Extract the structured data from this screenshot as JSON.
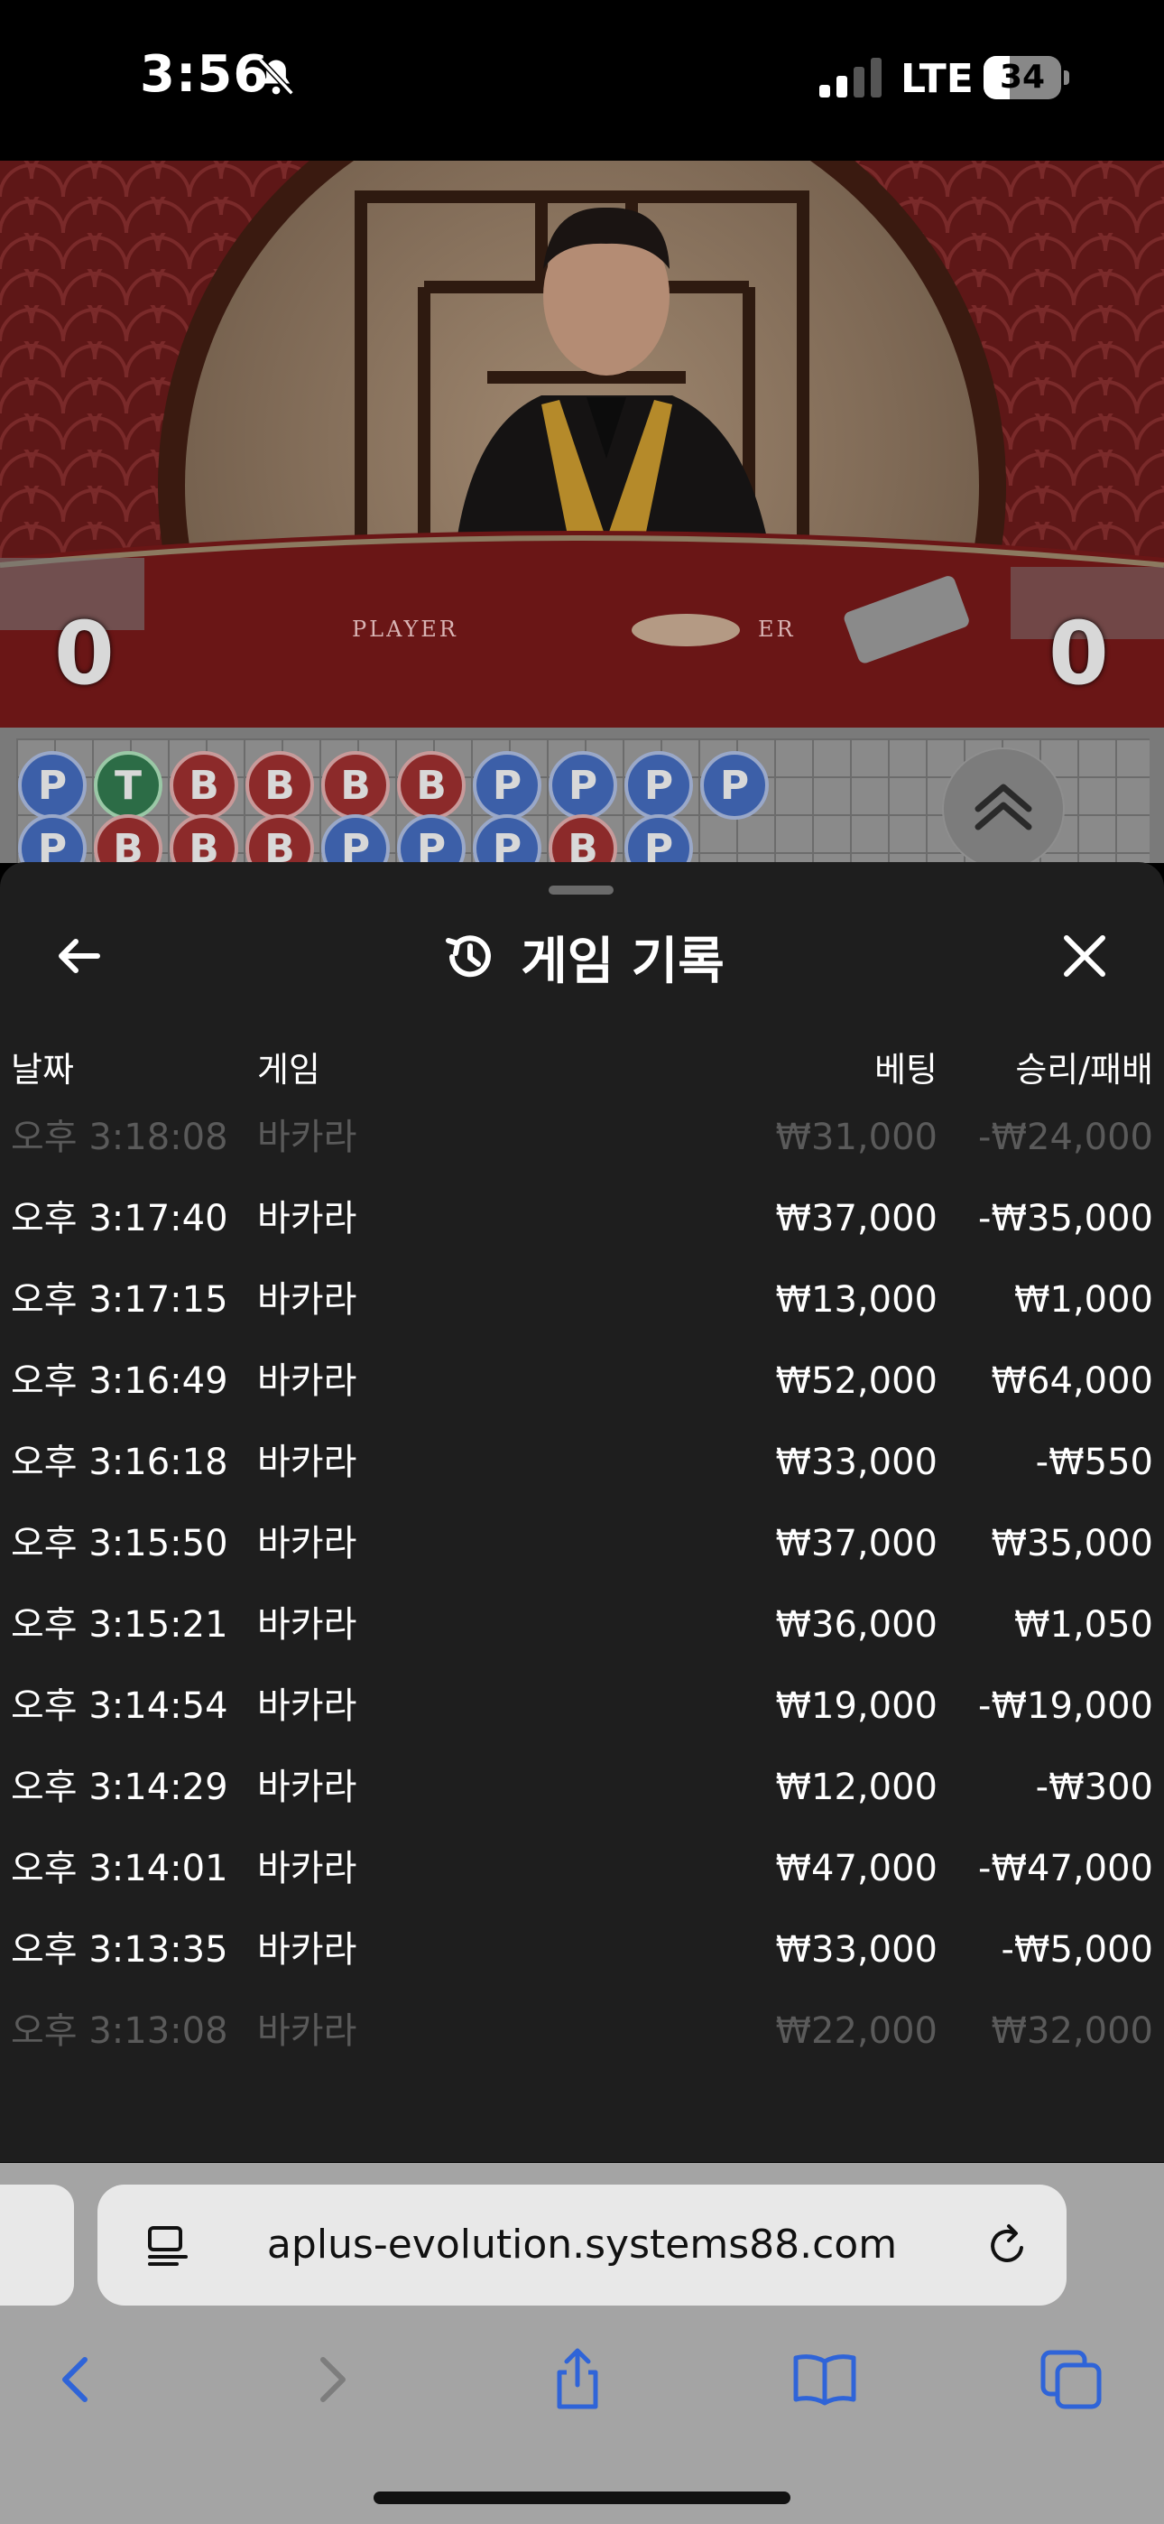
{
  "status_bar": {
    "time": "3:56",
    "network": "LTE",
    "battery_level": "34",
    "battery_fraction": 0.34
  },
  "video": {
    "player_score": "0",
    "banker_score": "0",
    "table_label_player": "PLAYER",
    "table_label_banker": "ER"
  },
  "roadmap": {
    "row1": [
      "P",
      "T",
      "B",
      "B",
      "B",
      "B",
      "P",
      "P",
      "P",
      "P"
    ],
    "row2": [
      "P",
      "B",
      "B",
      "B",
      "P",
      "P",
      "P",
      "B",
      "P"
    ]
  },
  "history": {
    "title": "게임 기록",
    "columns": {
      "date": "날짜",
      "game": "게임",
      "bet": "베팅",
      "result": "승리/패배"
    },
    "rows": [
      {
        "time": "오후 3:18:08",
        "game": "바카라",
        "bet": "₩31,000",
        "result": "-₩24,000",
        "faded": true
      },
      {
        "time": "오후 3:17:40",
        "game": "바카라",
        "bet": "₩37,000",
        "result": "-₩35,000"
      },
      {
        "time": "오후 3:17:15",
        "game": "바카라",
        "bet": "₩13,000",
        "result": "₩1,000"
      },
      {
        "time": "오후 3:16:49",
        "game": "바카라",
        "bet": "₩52,000",
        "result": "₩64,000"
      },
      {
        "time": "오후 3:16:18",
        "game": "바카라",
        "bet": "₩33,000",
        "result": "-₩550"
      },
      {
        "time": "오후 3:15:50",
        "game": "바카라",
        "bet": "₩37,000",
        "result": "₩35,000"
      },
      {
        "time": "오후 3:15:21",
        "game": "바카라",
        "bet": "₩36,000",
        "result": "₩1,050"
      },
      {
        "time": "오후 3:14:54",
        "game": "바카라",
        "bet": "₩19,000",
        "result": "-₩19,000"
      },
      {
        "time": "오후 3:14:29",
        "game": "바카라",
        "bet": "₩12,000",
        "result": "-₩300"
      },
      {
        "time": "오후 3:14:01",
        "game": "바카라",
        "bet": "₩47,000",
        "result": "-₩47,000"
      },
      {
        "time": "오후 3:13:35",
        "game": "바카라",
        "bet": "₩33,000",
        "result": "-₩5,000"
      },
      {
        "time": "오후 3:13:08",
        "game": "바카라",
        "bet": "₩22,000",
        "result": "₩32,000",
        "faded": true
      }
    ]
  },
  "browser": {
    "url": "aplus-evolution.systems88.com",
    "toolbar": [
      "back-icon",
      "forward-icon",
      "share-icon",
      "bookmarks-icon",
      "tabs-icon"
    ]
  },
  "colors": {
    "sheet_bg": "#1e1e1e",
    "player_blue": "#3c5fa8",
    "banker_red": "#8c2a2a",
    "tie_green": "#2c6c46",
    "safari_link_blue": "#2f64d8"
  }
}
